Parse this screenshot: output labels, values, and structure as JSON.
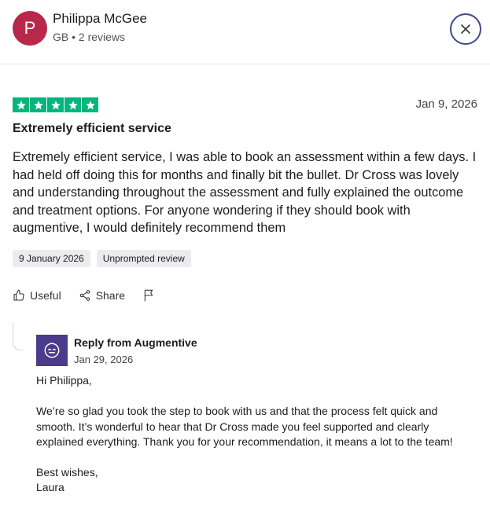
{
  "reviewer": {
    "initial": "P",
    "name": "Philippa McGee",
    "meta": "GB • 2 reviews"
  },
  "review": {
    "rating": 5,
    "date": "Jan 9, 2026",
    "title": "Extremely efficient service",
    "body": "Extremely efficient service, I was able to book an assessment within a few days. I had held off doing this for months and finally bit the bullet. Dr Cross was lovely and understanding throughout the assessment and fully explained the outcome and treatment options. For anyone wondering if they should book with augmentive, I would definitely recommend them",
    "tags": [
      "9 January 2026",
      "Unprompted review"
    ]
  },
  "actions": {
    "useful_label": "Useful",
    "share_label": "Share"
  },
  "reply": {
    "from": "Reply from Augmentive",
    "date": "Jan 29, 2026",
    "greeting": "Hi Philippa,",
    "body": "We’re so glad you took the step to book with us and that the process felt quick and smooth. It’s wonderful to hear that Dr Cross made you feel supported and clearly explained everything. Thank you for your recommendation, it means a lot to the team!",
    "signoff": "Best wishes,",
    "signature": "Laura"
  },
  "colors": {
    "star_green": "#00b67a",
    "avatar_bg": "#b8284a",
    "reply_logo_bg": "#4b3b8c",
    "close_border": "#3b4a8c"
  },
  "icons": [
    "close-icon",
    "star-icon",
    "thumbs-up-icon",
    "share-icon",
    "flag-icon",
    "augmentive-logo"
  ]
}
